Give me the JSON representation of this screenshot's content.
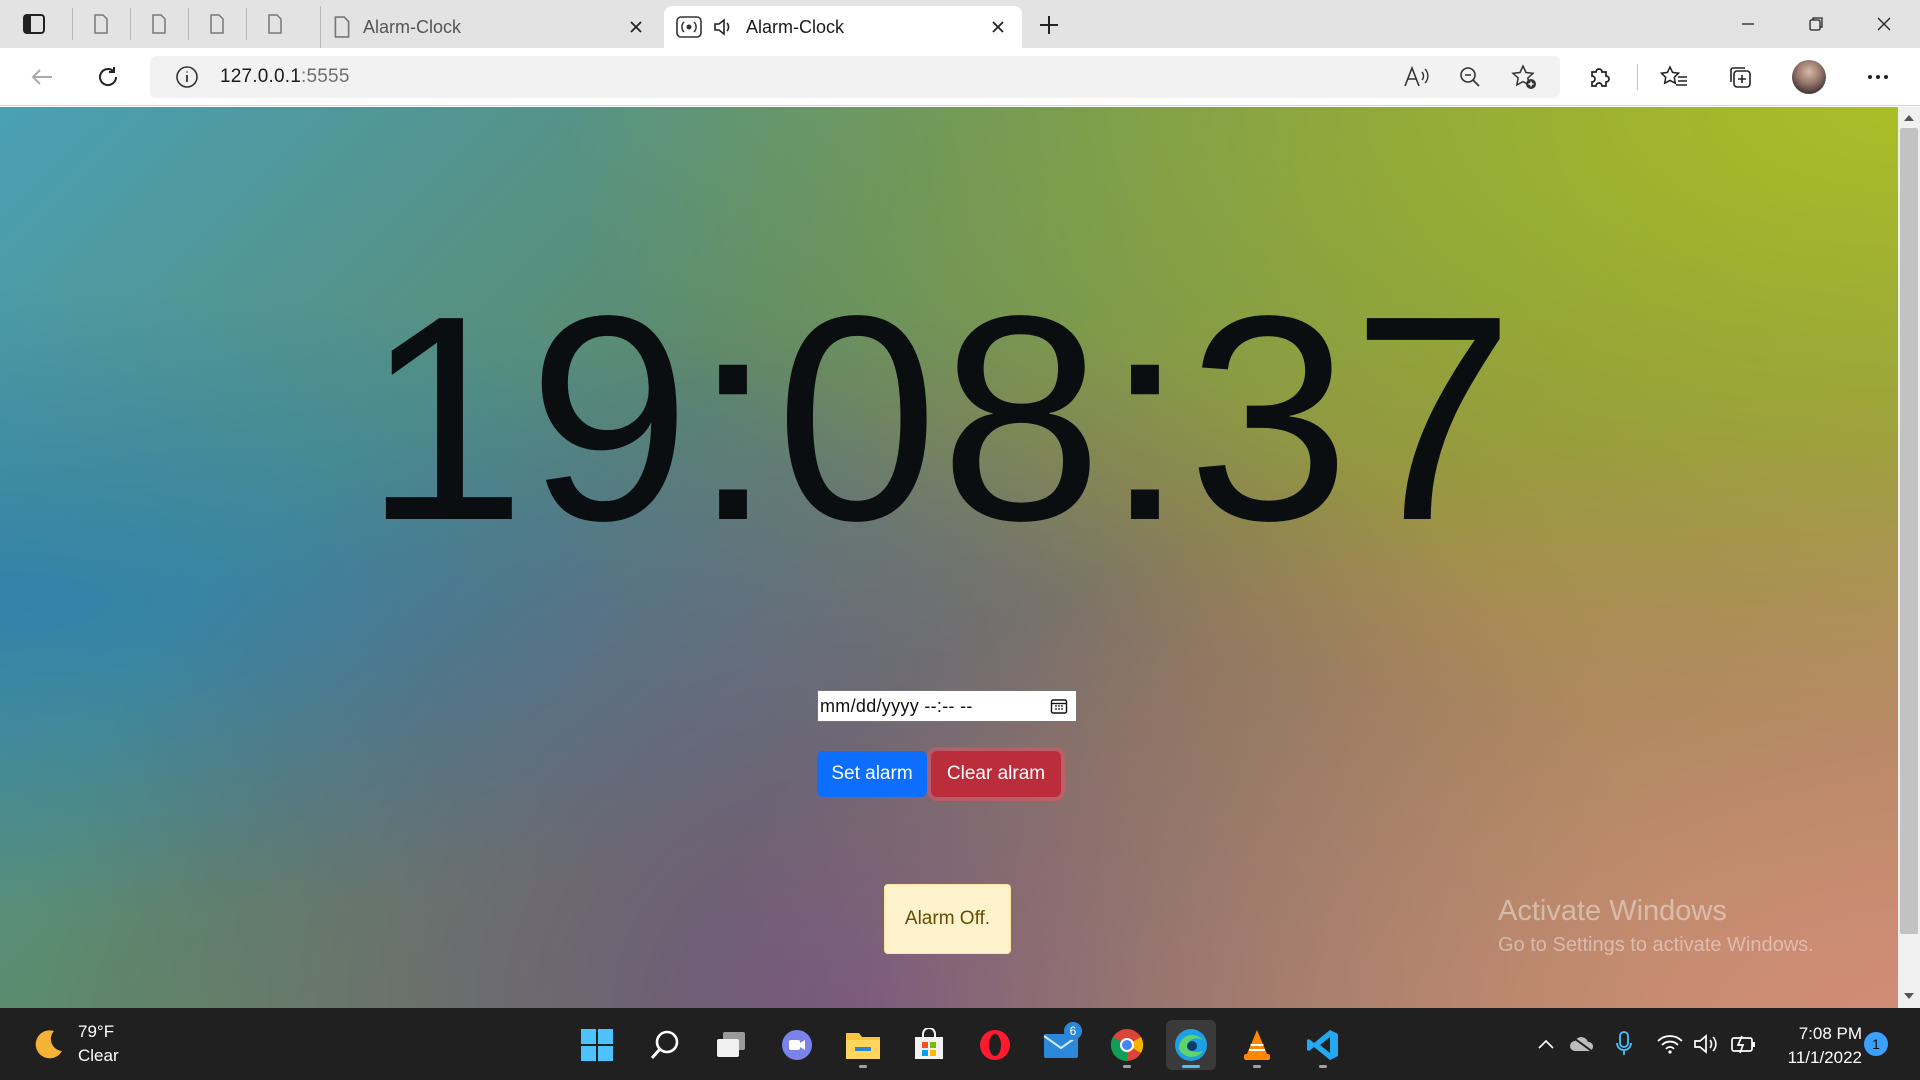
{
  "browser": {
    "tabs": [
      {
        "title": "Alarm-Clock",
        "active": false,
        "icon": "document-icon"
      },
      {
        "title": "Alarm-Clock",
        "active": true,
        "icon": "broadcast-icon",
        "audio": "speaker-icon"
      }
    ],
    "url": {
      "host": "127.0.0.1",
      "port": ":5555"
    }
  },
  "page": {
    "clock_time": "19:08:37",
    "datetime_placeholder": "mm/dd/yyyy --:-- --",
    "set_button": "Set alarm",
    "clear_button": "Clear alram",
    "status": "Alarm Off.",
    "watermark_title": "Activate Windows",
    "watermark_subtitle": "Go to Settings to activate Windows."
  },
  "taskbar": {
    "weather_temp": "79°F",
    "weather_cond": "Clear",
    "time": "7:08 PM",
    "date": "11/1/2022",
    "mail_badge": "6",
    "notifications": "1"
  },
  "colors": {
    "set_button": "#0d6efd",
    "clear_button": "#bb2d3b",
    "status_bg": "#fff3cd",
    "status_text": "#664d03",
    "taskbar": "#202020"
  }
}
